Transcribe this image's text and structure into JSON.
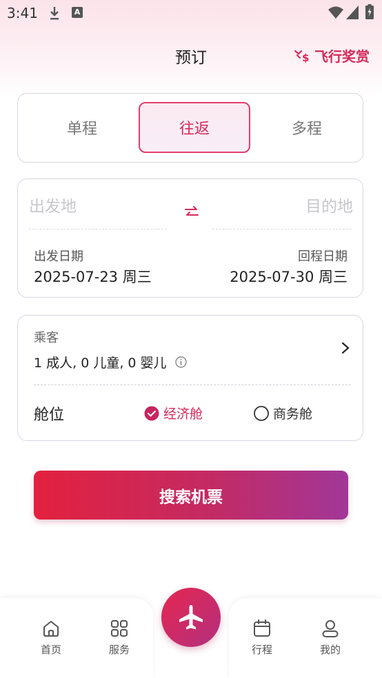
{
  "status_bar": {
    "time": "3:41",
    "a_label": "A"
  },
  "header": {
    "title": "预订",
    "rewards_label": "飞行奖赏"
  },
  "trip_types": [
    {
      "label": "单程",
      "selected": false
    },
    {
      "label": "往返",
      "selected": true
    },
    {
      "label": "多程",
      "selected": false
    }
  ],
  "route": {
    "origin_placeholder": "出发地",
    "destination_placeholder": "目的地",
    "depart_label": "出发日期",
    "depart_value": "2025-07-23 周三",
    "return_label": "回程日期",
    "return_value": "2025-07-30 周三"
  },
  "passengers": {
    "label": "乘客",
    "value": "1 成人, 0 儿童, 0 婴儿"
  },
  "cabin": {
    "label": "舱位",
    "options": [
      {
        "label": "经济舱",
        "selected": true
      },
      {
        "label": "商务舱",
        "selected": false
      }
    ]
  },
  "search_button": "搜索机票",
  "tab_bar": [
    {
      "label": "首页",
      "icon": "home-icon"
    },
    {
      "label": "服务",
      "icon": "grid-icon"
    },
    {
      "label": "行程",
      "icon": "calendar-icon"
    },
    {
      "label": "我的",
      "icon": "user-icon"
    }
  ],
  "colors": {
    "accent": "#d8285a",
    "gradient_start": "#e3213f",
    "gradient_end": "#a13798"
  }
}
